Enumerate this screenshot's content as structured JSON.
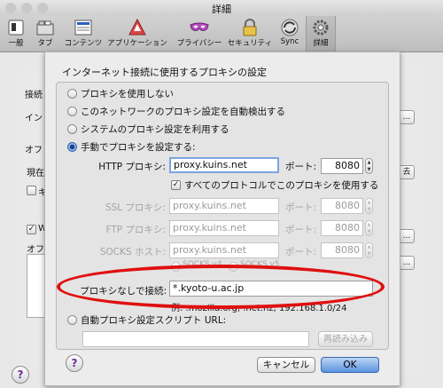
{
  "window": {
    "title": "詳細"
  },
  "toolbar": {
    "items": [
      {
        "label": "一般",
        "icon": "general-icon"
      },
      {
        "label": "タブ",
        "icon": "tabs-icon"
      },
      {
        "label": "コンテンツ",
        "icon": "content-icon"
      },
      {
        "label": "アプリケーション",
        "icon": "applications-icon"
      },
      {
        "label": "プライバシー",
        "icon": "privacy-mask-icon"
      },
      {
        "label": "セキュリティ",
        "icon": "lock-icon"
      },
      {
        "label": "Sync",
        "icon": "sync-icon"
      },
      {
        "label": "詳細",
        "icon": "gear-icon"
      }
    ],
    "selected": "詳細"
  },
  "background": {
    "conn_label": "接続",
    "conn_text": "イン",
    "conn_button": "...",
    "offline_label": "オフ",
    "now_text": "現在",
    "cb1_text": "キ",
    "clear_button": "去",
    "cb2_text": "W",
    "offline2_text": "オフ",
    "dots_button": "...",
    "del_button": "..."
  },
  "dialog": {
    "title": "インターネット接続に使用するプロキシの設定",
    "radios": {
      "none": "プロキシを使用しない",
      "auto_detect": "このネットワークのプロキシ設定を自動検出する",
      "system": "システムのプロキシ設定を利用する",
      "manual": "手動でプロキシを設定する:",
      "pac": "自動プロキシ設定スクリプト URL:"
    },
    "selected_radio": "manual",
    "http": {
      "label": "HTTP プロキシ:",
      "host": "proxy.kuins.net",
      "port_label": "ポート:",
      "port": "8080"
    },
    "use_all": {
      "label": "すべてのプロトコルでこのプロキシを使用する",
      "checked": true
    },
    "ssl": {
      "label": "SSL プロキシ:",
      "host": "proxy.kuins.net",
      "port_label": "ポート:",
      "port": "8080"
    },
    "ftp": {
      "label": "FTP プロキシ:",
      "host": "proxy.kuins.net",
      "port_label": "ポート:",
      "port": "8080"
    },
    "socks": {
      "label": "SOCKS ホスト:",
      "host": "proxy.kuins.net",
      "port_label": "ポート:",
      "port": "8080"
    },
    "socks_versions": {
      "v4": "SOCKS v4",
      "v5": "SOCKS v5"
    },
    "no_proxy": {
      "label": "プロキシなしで接続:",
      "value": "*.kyoto-u.ac.jp",
      "example": "例: .mozilla.org, .net.nz, 192.168.1.0/24"
    },
    "pac_url": "",
    "reload_button": "再読み込み",
    "cancel_button": "キャンセル",
    "ok_button": "OK",
    "help_label": "?"
  },
  "colors": {
    "highlight": "#e00f0f",
    "accent": "#5b93e0"
  }
}
